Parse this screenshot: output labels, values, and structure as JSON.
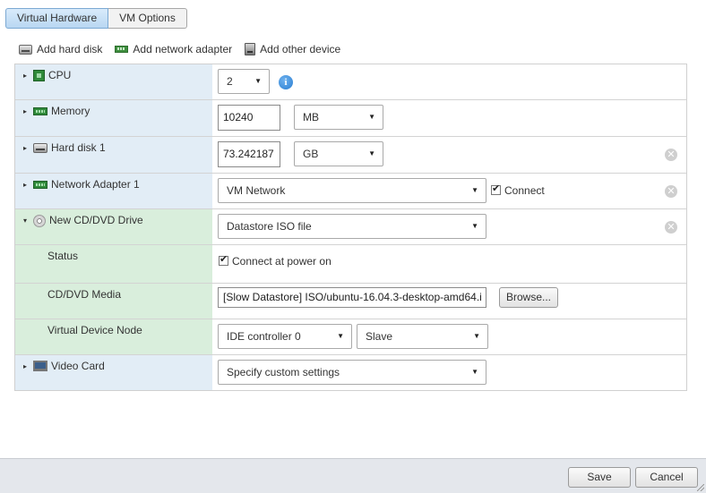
{
  "tabs": {
    "virtual_hardware": "Virtual Hardware",
    "vm_options": "VM Options"
  },
  "toolbar": {
    "add_hard_disk": "Add hard disk",
    "add_network_adapter": "Add network adapter",
    "add_other_device": "Add other device"
  },
  "rows": {
    "cpu": {
      "label": "CPU",
      "value": "2"
    },
    "memory": {
      "label": "Memory",
      "value": "10240",
      "unit": "MB"
    },
    "hard_disk": {
      "label": "Hard disk 1",
      "value": "73.242187",
      "unit": "GB"
    },
    "network": {
      "label": "Network Adapter 1",
      "value": "VM Network",
      "connect_label": "Connect"
    },
    "cd": {
      "label": "New CD/DVD Drive",
      "value": "Datastore ISO file"
    },
    "status": {
      "label": "Status",
      "checkbox_label": "Connect at power on"
    },
    "media": {
      "label": "CD/DVD Media",
      "value": "[Slow Datastore] ISO/ubuntu-16.04.3-desktop-amd64.i",
      "browse_label": "Browse..."
    },
    "node": {
      "label": "Virtual Device Node",
      "controller": "IDE controller 0",
      "position": "Slave"
    },
    "video": {
      "label": "Video Card",
      "value": "Specify custom settings"
    }
  },
  "footer": {
    "save_label": "Save",
    "cancel_label": "Cancel"
  },
  "glyphs": {
    "caret_right": "▸",
    "caret_down": "▾",
    "dropdown_arrow": "▼",
    "info": "i",
    "remove": "✕"
  },
  "colors": {
    "label_blue": "#e2edf6",
    "label_green": "#d9eedc",
    "tab_active": "#b9d7f2",
    "info_blue": "#2a7ed1"
  }
}
